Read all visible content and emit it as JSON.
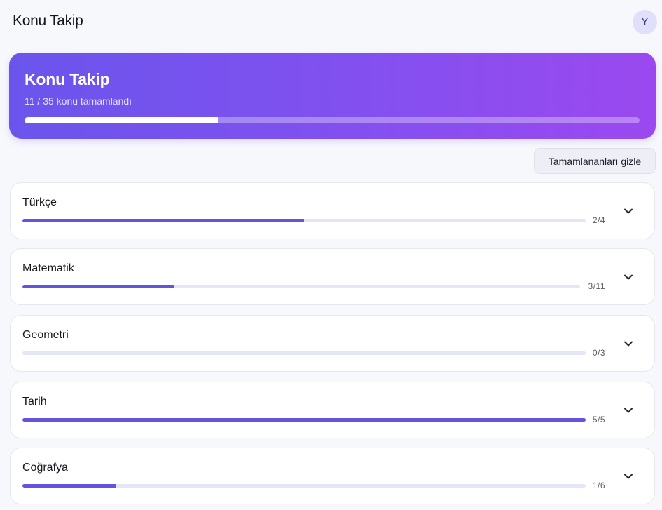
{
  "app": {
    "title": "Konu Takip",
    "avatar_initial": "Y"
  },
  "hero": {
    "title": "Konu Takip",
    "subtitle": "11 / 35 konu tamamlandı",
    "progress_fraction": 0.314
  },
  "toolbar": {
    "hide_completed_label": "Tamamlananları gizle"
  },
  "subjects": [
    {
      "name": "Türkçe",
      "done": 2,
      "total": 4,
      "count_label": "2/4"
    },
    {
      "name": "Matematik",
      "done": 3,
      "total": 11,
      "count_label": "3/11"
    },
    {
      "name": "Geometri",
      "done": 0,
      "total": 3,
      "count_label": "0/3"
    },
    {
      "name": "Tarih",
      "done": 5,
      "total": 5,
      "count_label": "5/5"
    },
    {
      "name": "Coğrafya",
      "done": 1,
      "total": 6,
      "count_label": "1/6"
    }
  ],
  "colors": {
    "accent": "#6253e0",
    "hero_gradient_start": "#6a55ec",
    "hero_gradient_end": "#9a49ef",
    "track": "#e5e6f4"
  },
  "icons": {
    "expand": "chevron-down-icon"
  }
}
